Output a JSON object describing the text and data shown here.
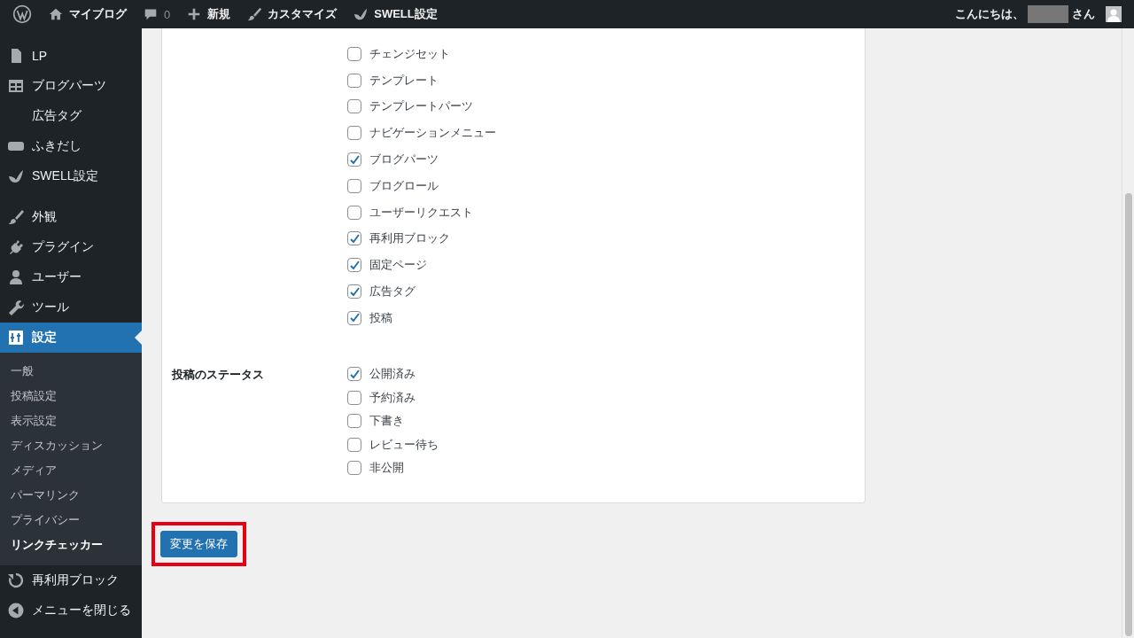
{
  "admin_bar": {
    "items": [
      {
        "kind": "logo"
      },
      {
        "kind": "link",
        "label": "マイブログ"
      },
      {
        "kind": "counter",
        "label": "0"
      },
      {
        "kind": "link",
        "label": "新規"
      },
      {
        "kind": "link",
        "label": "カスタマイズ"
      },
      {
        "kind": "link",
        "label": "SWELL設定"
      }
    ],
    "greeting": "こんにちは、",
    "greeting_suffix": "さん"
  },
  "sidebar": {
    "sections": [
      {
        "menu": [
          {
            "label": "LP",
            "selected": false
          },
          {
            "label": "ブログパーツ",
            "selected": false
          },
          {
            "label": "広告タグ",
            "selected": false
          },
          {
            "label": "ふきだし",
            "selected": false
          },
          {
            "label": "SWELL設定",
            "selected": false
          }
        ]
      },
      {
        "menu": [
          {
            "label": "外観",
            "selected": false
          },
          {
            "label": "プラグイン",
            "selected": false
          },
          {
            "label": "ユーザー",
            "selected": false
          },
          {
            "label": "ツール",
            "selected": false
          },
          {
            "label": "設定",
            "selected": true,
            "submenu": [
              {
                "label": "一般",
                "selected": false
              },
              {
                "label": "投稿設定",
                "selected": false
              },
              {
                "label": "表示設定",
                "selected": false
              },
              {
                "label": "ディスカッション",
                "selected": false
              },
              {
                "label": "メディア",
                "selected": false
              },
              {
                "label": "パーマリンク",
                "selected": false
              },
              {
                "label": "プライバシー",
                "selected": false
              },
              {
                "label": "リンクチェッカー",
                "selected": true
              }
            ]
          },
          {
            "label": "再利用ブロック",
            "selected": false
          },
          {
            "label": "メニューを閉じる",
            "selected": false
          }
        ]
      }
    ]
  },
  "settings": {
    "groups": [
      {
        "options": [
          {
            "label": "チェンジセット",
            "checked": false
          },
          {
            "label": "テンプレート",
            "checked": false
          },
          {
            "label": "テンプレートパーツ",
            "checked": false
          },
          {
            "label": "ナビゲーションメニュー",
            "checked": false
          },
          {
            "label": "ブログパーツ",
            "checked": true
          },
          {
            "label": "ブログロール",
            "checked": false
          },
          {
            "label": "ユーザーリクエスト",
            "checked": false
          },
          {
            "label": "再利用ブロック",
            "checked": true
          },
          {
            "label": "固定ページ",
            "checked": true
          },
          {
            "label": "広告タグ",
            "checked": true
          },
          {
            "label": "投稿",
            "checked": true
          }
        ]
      },
      {
        "label": "投稿のステータス",
        "options": [
          {
            "label": "公開済み",
            "checked": true
          },
          {
            "label": "予約済み",
            "checked": false
          },
          {
            "label": "下書き",
            "checked": false
          },
          {
            "label": "レビュー待ち",
            "checked": false
          },
          {
            "label": "非公開",
            "checked": false
          }
        ]
      }
    ]
  },
  "save_button": {
    "label": "変更を保存",
    "highlighted": true
  }
}
